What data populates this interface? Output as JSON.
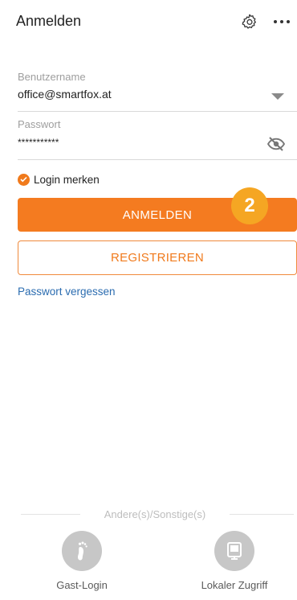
{
  "header": {
    "title": "Anmelden",
    "settings_icon": "gear-icon",
    "more_icon": "more-dots-icon"
  },
  "username": {
    "label": "Benutzername",
    "value": "office@smartfox.at",
    "dropdown_icon": "triangle-down-icon"
  },
  "password": {
    "label": "Passwort",
    "value": "***********",
    "visibility_icon": "eye-off-icon"
  },
  "remember": {
    "label": "Login merken",
    "checked": true
  },
  "buttons": {
    "login_label": "ANMELDEN",
    "register_label": "REGISTRIEREN"
  },
  "step_badge": "2",
  "forgot_link": "Passwort vergessen",
  "others": {
    "divider_label": "Andere(s)/Sonstige(s)",
    "guest_label": "Gast-Login",
    "guest_icon": "footprint-icon",
    "local_label": "Lokaler Zugriff",
    "local_icon": "device-icon"
  },
  "colors": {
    "accent": "#f47b20",
    "badge": "#f5a623",
    "link": "#2b6cb0",
    "alt_icon_bg": "#c7c7c7"
  }
}
